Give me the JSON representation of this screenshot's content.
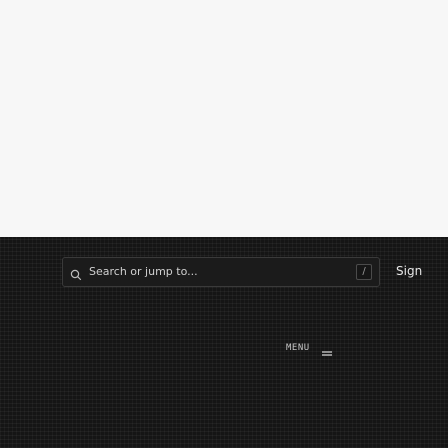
{
  "header": {
    "search": {
      "placeholder": "Search or jump to...",
      "shortcut": "/"
    },
    "sign_label": "Sign"
  },
  "menu": {
    "label": "MENU"
  },
  "icons": {
    "search": "search-icon",
    "menu": "menu-icon"
  },
  "colors": {
    "top_background": "#f7f7f7",
    "dark_background": "#151515",
    "search_background": "#1b1b1b",
    "search_border": "#3a3a3a",
    "text_primary": "#e8e8e8",
    "text_secondary": "#d0d0d0"
  }
}
